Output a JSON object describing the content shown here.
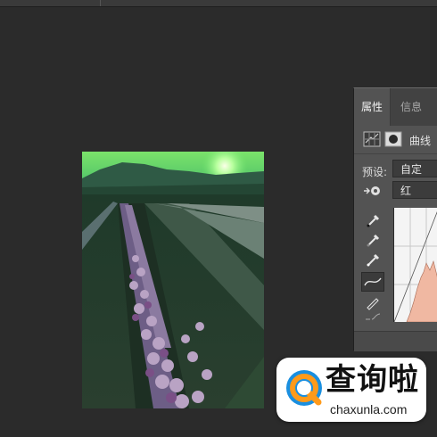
{
  "panel": {
    "tabs": [
      "属性",
      "信息"
    ],
    "adjustment_title": "曲线",
    "preset_label": "预设:",
    "preset_value": "自定",
    "channel_value": "红"
  },
  "badge": {
    "title": "查询啦",
    "url": "chaxunla.com"
  },
  "colors": {
    "app_background": "#2b2b2b",
    "panel_background": "#535353",
    "histogram_fill": "#f0b8a2"
  },
  "icons": [
    "adjustment-grid-icon",
    "mask-icon",
    "hand-target-icon",
    "eyedropper-black-icon",
    "eyedropper-gray-icon",
    "eyedropper-white-icon",
    "curve-point-icon",
    "pencil-icon",
    "smooth-curve-icon",
    "magnifier-q-icon"
  ]
}
